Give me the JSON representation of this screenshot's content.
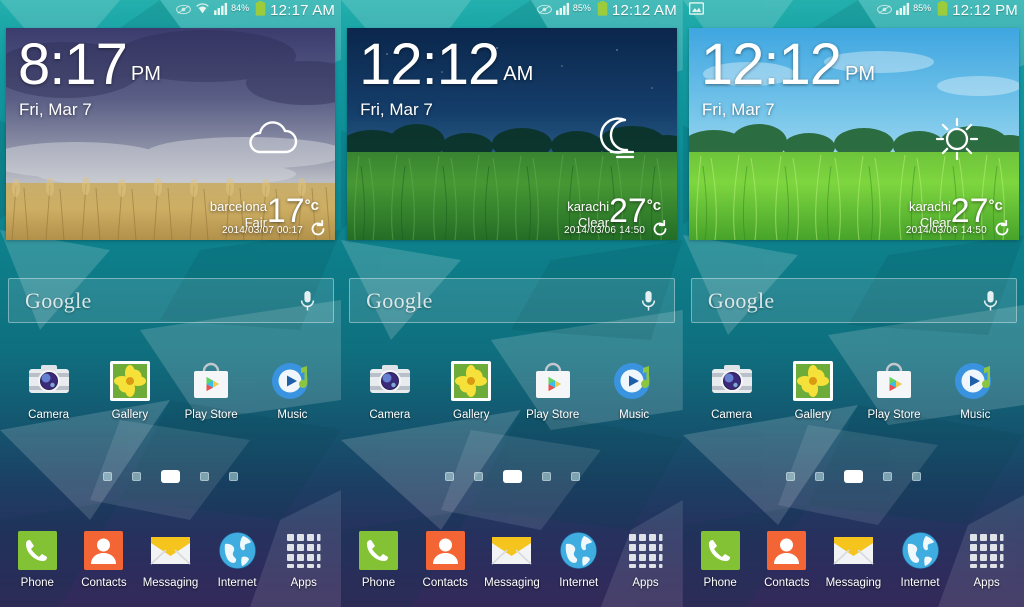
{
  "device": {
    "name": "Samsung Galaxy S5 TouchWiz home screen",
    "panel_count": 3
  },
  "colors": {
    "wallpaper_top": "#23b0ad",
    "wallpaper_mid": "#0d7f8a",
    "wallpaper_bottom": "#332a59",
    "status_text": "#ffffff",
    "battery_green": "#9ccc3c",
    "phone_green": "#76b72a",
    "contacts_orange": "#f0592b",
    "messaging_yellow": "#f5c51e",
    "internet_blue": "#2f9bd6",
    "apps_grey": "#d8d8d8"
  },
  "panels": [
    {
      "id": "panel-1",
      "statusbar": {
        "left_icons": [],
        "right_icons": [
          "smart-stay-eye-icon",
          "wifi-icon",
          "signal-bars-icon",
          "battery-icon"
        ],
        "battery_percent": "84%",
        "time": "12:17 AM"
      },
      "widget": {
        "type": "weather-clock-widget",
        "theme": "wheat-field-stormy-sky",
        "time": "8:17",
        "ampm": "PM",
        "date": "Fri, Mar 7",
        "weather_icon": "cloud-icon",
        "city": "barcelona",
        "condition": "Fair",
        "temperature": "17",
        "degree_unit": "°c",
        "updated": "2014/03/07 00:17",
        "refresh_icon": "refresh-icon"
      },
      "search": {
        "logo": "Google",
        "placeholder": "Google",
        "mic_icon": "microphone-icon"
      },
      "apps": [
        {
          "label": "Camera",
          "icon": "camera-icon"
        },
        {
          "label": "Gallery",
          "icon": "gallery-icon"
        },
        {
          "label": "Play Store",
          "icon": "play-store-icon"
        },
        {
          "label": "Music",
          "icon": "music-icon"
        }
      ],
      "page_indicator": {
        "count": 5,
        "active_index": 2
      },
      "dock": [
        {
          "label": "Phone",
          "icon": "phone-icon"
        },
        {
          "label": "Contacts",
          "icon": "contacts-icon"
        },
        {
          "label": "Messaging",
          "icon": "messaging-icon"
        },
        {
          "label": "Internet",
          "icon": "internet-globe-icon"
        },
        {
          "label": "Apps",
          "icon": "apps-grid-icon"
        }
      ]
    },
    {
      "id": "panel-2",
      "statusbar": {
        "left_icons": [],
        "right_icons": [
          "smart-stay-eye-icon",
          "signal-bars-icon",
          "battery-icon"
        ],
        "battery_percent": "85%",
        "time": "12:12 AM"
      },
      "widget": {
        "type": "weather-clock-widget",
        "theme": "green-grass-night-sky",
        "time": "12:12",
        "ampm": "AM",
        "date": "Fri, Mar 7",
        "weather_icon": "moon-icon",
        "city": "karachi",
        "condition": "Clear",
        "temperature": "27",
        "degree_unit": "°c",
        "updated": "2014/03/06 14:50",
        "refresh_icon": "refresh-icon"
      },
      "search": {
        "logo": "Google",
        "placeholder": "Google",
        "mic_icon": "microphone-icon"
      },
      "apps": [
        {
          "label": "Camera",
          "icon": "camera-icon"
        },
        {
          "label": "Gallery",
          "icon": "gallery-icon"
        },
        {
          "label": "Play Store",
          "icon": "play-store-icon"
        },
        {
          "label": "Music",
          "icon": "music-icon"
        }
      ],
      "page_indicator": {
        "count": 5,
        "active_index": 2
      },
      "dock": [
        {
          "label": "Phone",
          "icon": "phone-icon"
        },
        {
          "label": "Contacts",
          "icon": "contacts-icon"
        },
        {
          "label": "Messaging",
          "icon": "messaging-icon"
        },
        {
          "label": "Internet",
          "icon": "internet-globe-icon"
        },
        {
          "label": "Apps",
          "icon": "apps-grid-icon"
        }
      ]
    },
    {
      "id": "panel-3",
      "statusbar": {
        "left_icons": [
          "screenshot-image-icon"
        ],
        "right_icons": [
          "smart-stay-eye-icon",
          "signal-bars-icon",
          "battery-icon"
        ],
        "battery_percent": "85%",
        "time": "12:12 PM"
      },
      "widget": {
        "type": "weather-clock-widget",
        "theme": "green-grass-blue-sky",
        "time": "12:12",
        "ampm": "PM",
        "date": "Fri, Mar 7",
        "weather_icon": "sun-icon",
        "city": "karachi",
        "condition": "Clear",
        "temperature": "27",
        "degree_unit": "°c",
        "updated": "2014/03/06 14:50",
        "refresh_icon": "refresh-icon"
      },
      "search": {
        "logo": "Google",
        "placeholder": "Google",
        "mic_icon": "microphone-icon"
      },
      "apps": [
        {
          "label": "Camera",
          "icon": "camera-icon"
        },
        {
          "label": "Gallery",
          "icon": "gallery-icon"
        },
        {
          "label": "Play Store",
          "icon": "play-store-icon"
        },
        {
          "label": "Music",
          "icon": "music-icon"
        }
      ],
      "page_indicator": {
        "count": 5,
        "active_index": 2
      },
      "dock": [
        {
          "label": "Phone",
          "icon": "phone-icon"
        },
        {
          "label": "Contacts",
          "icon": "contacts-icon"
        },
        {
          "label": "Messaging",
          "icon": "messaging-icon"
        },
        {
          "label": "Internet",
          "icon": "internet-globe-icon"
        },
        {
          "label": "Apps",
          "icon": "apps-grid-icon"
        }
      ]
    }
  ]
}
